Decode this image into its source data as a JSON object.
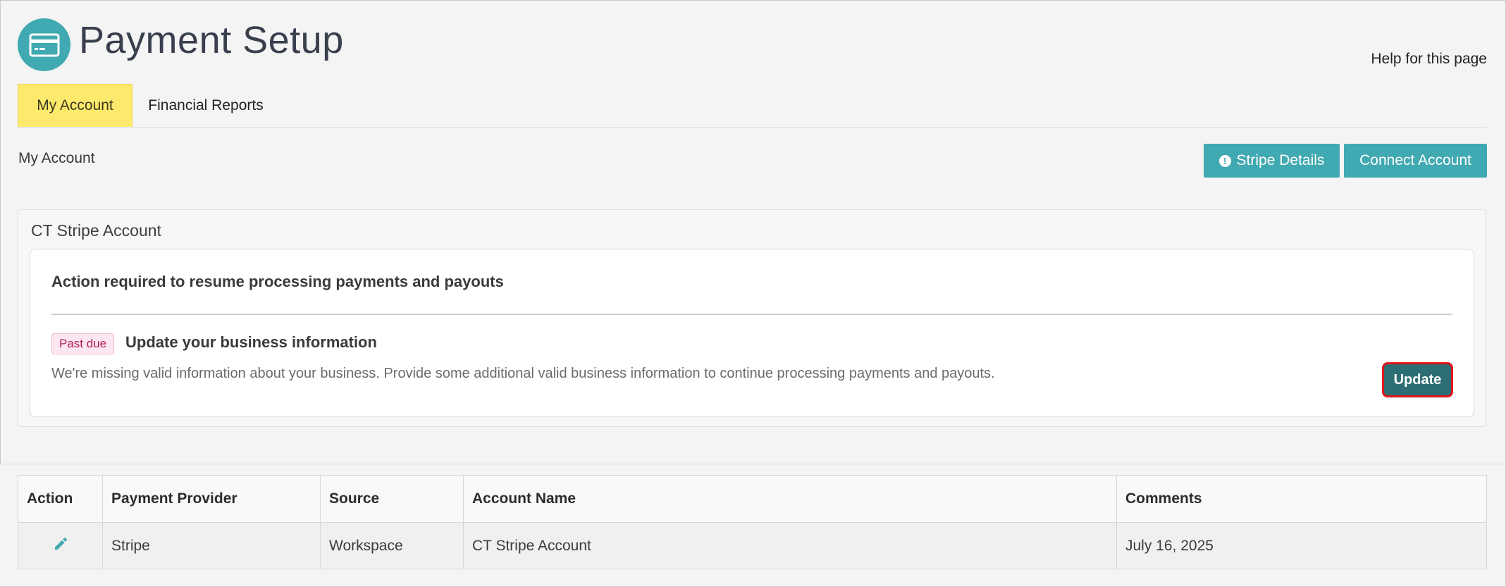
{
  "header": {
    "title": "Payment Setup",
    "icon": "credit-card-icon",
    "help_link": "Help for this page"
  },
  "tabs": [
    {
      "label": "My Account",
      "active": true
    },
    {
      "label": "Financial Reports",
      "active": false
    }
  ],
  "section": {
    "label": "My Account",
    "stripe_details_button": "Stripe Details",
    "connect_account_button": "Connect Account"
  },
  "account_card": {
    "title": "CT Stripe Account",
    "alert": {
      "heading": "Action required to resume processing payments and payouts",
      "badge": "Past due",
      "update_title": "Update your business information",
      "description": "We're missing valid information about your business. Provide some additional valid business information to continue processing payments and payouts.",
      "update_button": "Update"
    }
  },
  "table": {
    "headers": [
      "Action",
      "Payment Provider",
      "Source",
      "Account Name",
      "Comments"
    ],
    "rows": [
      {
        "action_icon": "pencil-edit-icon",
        "provider": "Stripe",
        "source": "Workspace",
        "account_name": "CT Stripe Account",
        "comments": "July 16, 2025"
      }
    ]
  },
  "colors": {
    "accent_teal": "#41a9b1",
    "active_tab": "#fde96b",
    "update_button": "#2c6e73",
    "highlight_border": "#e0141c",
    "badge_text": "#b0205c"
  }
}
